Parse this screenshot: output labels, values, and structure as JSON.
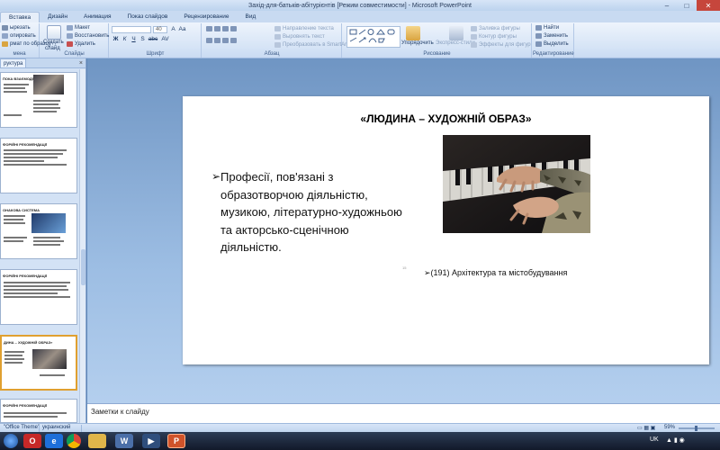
{
  "window": {
    "title": "Захід-для-батьків-абітурієнтів [Режим совместимости] - Microsoft PowerPoint",
    "controls": [
      "–",
      "□",
      "✕"
    ]
  },
  "tabs": [
    "Вставка",
    "Дизайн",
    "Анимация",
    "Показ слайдов",
    "Рецензирование",
    "Вид"
  ],
  "ribbon": {
    "clipboard": {
      "items": [
        "ырезать",
        "опировать",
        "рмат по образцу"
      ],
      "label": "мена"
    },
    "slides": {
      "new_slide": "Создать",
      "new_slide2": "слайд",
      "items": [
        "Макет",
        "Восстановить",
        "Удалить"
      ],
      "label": "Слайды"
    },
    "font": {
      "font_value": "",
      "size_value": "40",
      "label": "Шрифт",
      "buttons": [
        "Ж",
        "К",
        "Ч",
        "S",
        "abc",
        "AV",
        "Aa",
        "A"
      ]
    },
    "paragraph": {
      "items": [
        "Направление текста",
        "Выровнять текст",
        "Преобразовать в SmartArt"
      ],
      "label": "Абзац"
    },
    "drawing": {
      "arrange": "Упорядочить",
      "quick_styles": "Экспресс-стили",
      "items": [
        "Заливка фигуры",
        "Контур фигуры",
        "Эффекты для фигур"
      ],
      "label": "Рисование"
    },
    "editing": {
      "items": [
        "Найти",
        "Заменить",
        "Выделить"
      ],
      "label": "Редактирование"
    }
  },
  "left_panel": {
    "tabs": [
      "руктура"
    ],
    "close": "×",
    "thumbnails": [
      {
        "title": "ПОКА ВЗАЄМОДІЇ (ПАРИТЕТ)"
      },
      {
        "title": "ФОРІЙНІ РЕКОМЕНДАЦІЇ"
      },
      {
        "title": "ОНАКОВА СИСТЕМА"
      },
      {
        "title": "ФОРІЙНІ РЕКОМЕНДАЦІЇ"
      },
      {
        "title": "ДИНА – ХУДОЖНІЙ ОБРАЗ»"
      },
      {
        "title": "ФОРІЙНІ РЕКОМЕНДАЦІЇ"
      }
    ]
  },
  "slide": {
    "title": "«ЛЮДИНА – ХУДОЖНІЙ ОБРАЗ»",
    "bullet": "Професії, пов'язані з образотворчою діяльністю, музикою, літературно-художньою та акторсько-сценічною діяльністю.",
    "bullet_marker": "➢",
    "sub_item": "(191) Архітектура та містобудування",
    "tiny_mark": "15"
  },
  "notes": {
    "placeholder": "Заметки к слайду"
  },
  "status_bar": {
    "theme": "\"Office Theme\"",
    "language": "украинский",
    "zoom": "59%"
  },
  "taskbar": {
    "lang": "UK",
    "apps": [
      "O",
      "IE",
      "Chrome",
      "Folder",
      "PowerPoint",
      "Word",
      "Media"
    ]
  }
}
